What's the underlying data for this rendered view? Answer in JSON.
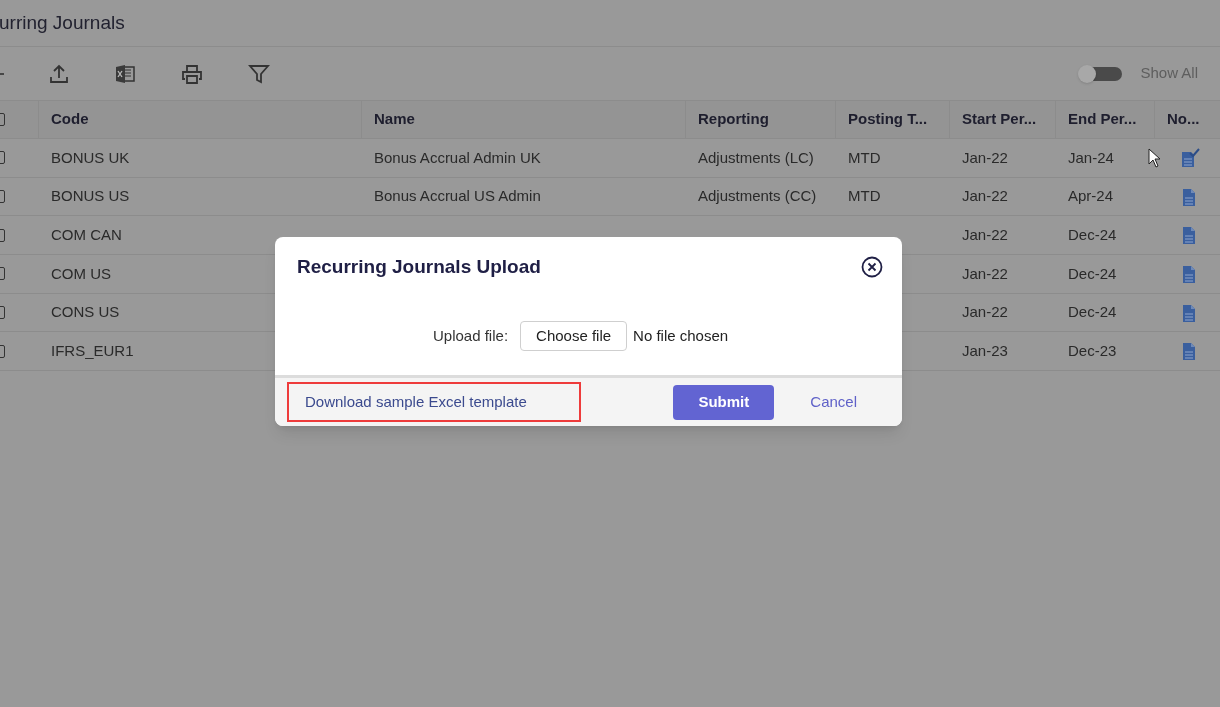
{
  "page": {
    "title": "urring Journals"
  },
  "toolbar": {
    "show_all": {
      "label": "Show All",
      "on": false
    }
  },
  "table": {
    "select_all_checked": false,
    "columns": [
      "Code",
      "Name",
      "Reporting",
      "Posting T...",
      "Start Per...",
      "End Per...",
      "No..."
    ],
    "rows": [
      {
        "checked": false,
        "code": "BONUS UK",
        "name": "Bonus Accrual Admin UK",
        "reporting": "Adjustments (LC)",
        "posting": "MTD",
        "start": "Jan-22",
        "end": "Jan-24",
        "note_checked": true
      },
      {
        "checked": false,
        "code": "BONUS US",
        "name": "Bonus Accrual US Admin",
        "reporting": "Adjustments (CC)",
        "posting": "MTD",
        "start": "Jan-22",
        "end": "Apr-24",
        "note_checked": false
      },
      {
        "checked": false,
        "code": "COM CAN",
        "start": "Jan-22",
        "end": "Dec-24",
        "note_checked": false
      },
      {
        "checked": false,
        "code": "COM US",
        "start": "Jan-22",
        "end": "Dec-24",
        "note_checked": false
      },
      {
        "checked": false,
        "code": "CONS US",
        "start": "Jan-22",
        "end": "Dec-24",
        "note_checked": false
      },
      {
        "checked": false,
        "code": "IFRS_EUR1",
        "start": "Jan-23",
        "end": "Dec-23",
        "note_checked": false
      }
    ]
  },
  "dialog": {
    "title": "Recurring Journals Upload",
    "upload_label": "Upload file:",
    "choose_button": "Choose file",
    "file_status": "No file chosen",
    "template_link": {
      "label": "Download sample Excel template",
      "highlighted": true
    },
    "submit": "Submit",
    "cancel": "Cancel"
  }
}
